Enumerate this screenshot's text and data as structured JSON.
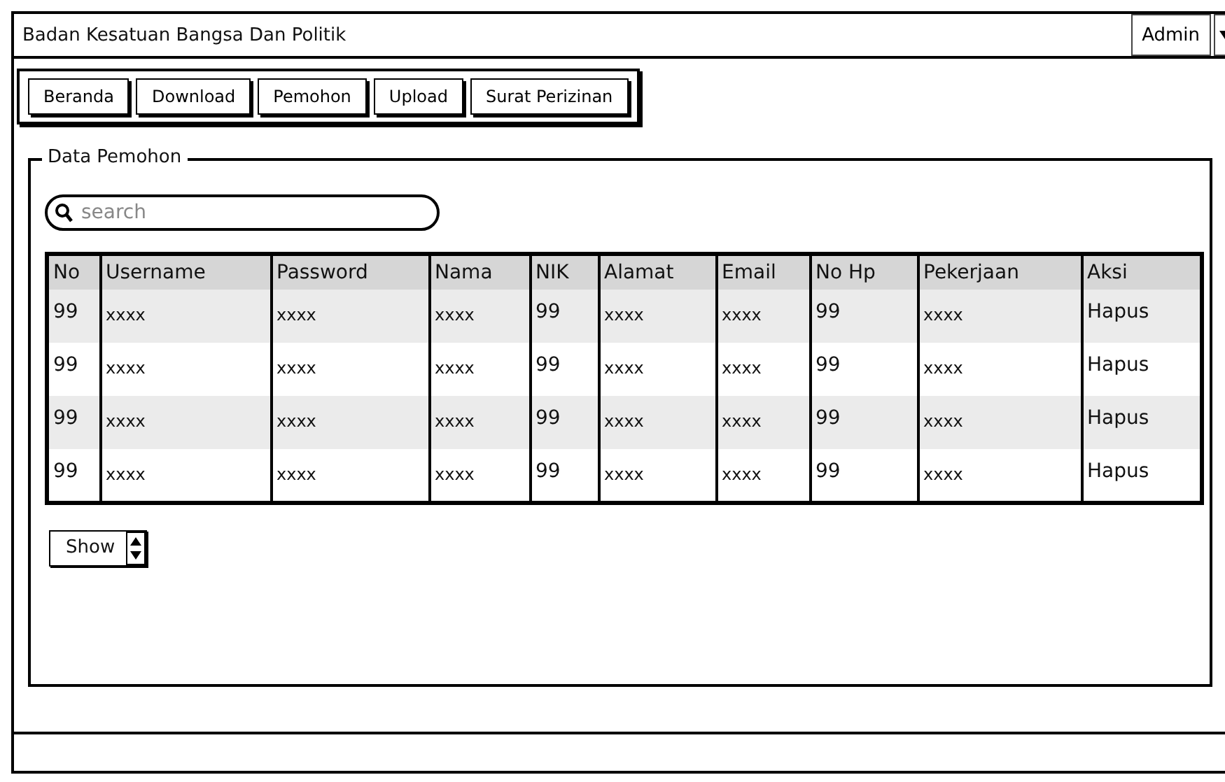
{
  "window": {
    "title": "Badan Kesatuan Bangsa Dan Politik",
    "user_menu": "Admin"
  },
  "nav": [
    {
      "label": "Beranda"
    },
    {
      "label": "Download"
    },
    {
      "label": "Pemohon"
    },
    {
      "label": "Upload"
    },
    {
      "label": "Surat Perizinan"
    }
  ],
  "panel": {
    "title": "Data Pemohon",
    "search": {
      "placeholder": "search"
    },
    "table": {
      "columns": [
        "No",
        "Username",
        "Password",
        "Nama",
        "NIK",
        "Alamat",
        "Email",
        "No Hp",
        "Pekerjaan",
        "Aksi"
      ],
      "rows": [
        [
          "99",
          "xxxx",
          "xxxx",
          "xxxx",
          "99",
          "xxxx",
          "xxxx",
          "99",
          "xxxx",
          "Hapus"
        ],
        [
          "99",
          "xxxx",
          "xxxx",
          "xxxx",
          "99",
          "xxxx",
          "xxxx",
          "99",
          "xxxx",
          "Hapus"
        ],
        [
          "99",
          "xxxx",
          "xxxx",
          "xxxx",
          "99",
          "xxxx",
          "xxxx",
          "99",
          "xxxx",
          "Hapus"
        ],
        [
          "99",
          "xxxx",
          "xxxx",
          "xxxx",
          "99",
          "xxxx",
          "xxxx",
          "99",
          "xxxx",
          "Hapus"
        ]
      ]
    },
    "page_size": {
      "value": "Show"
    }
  }
}
